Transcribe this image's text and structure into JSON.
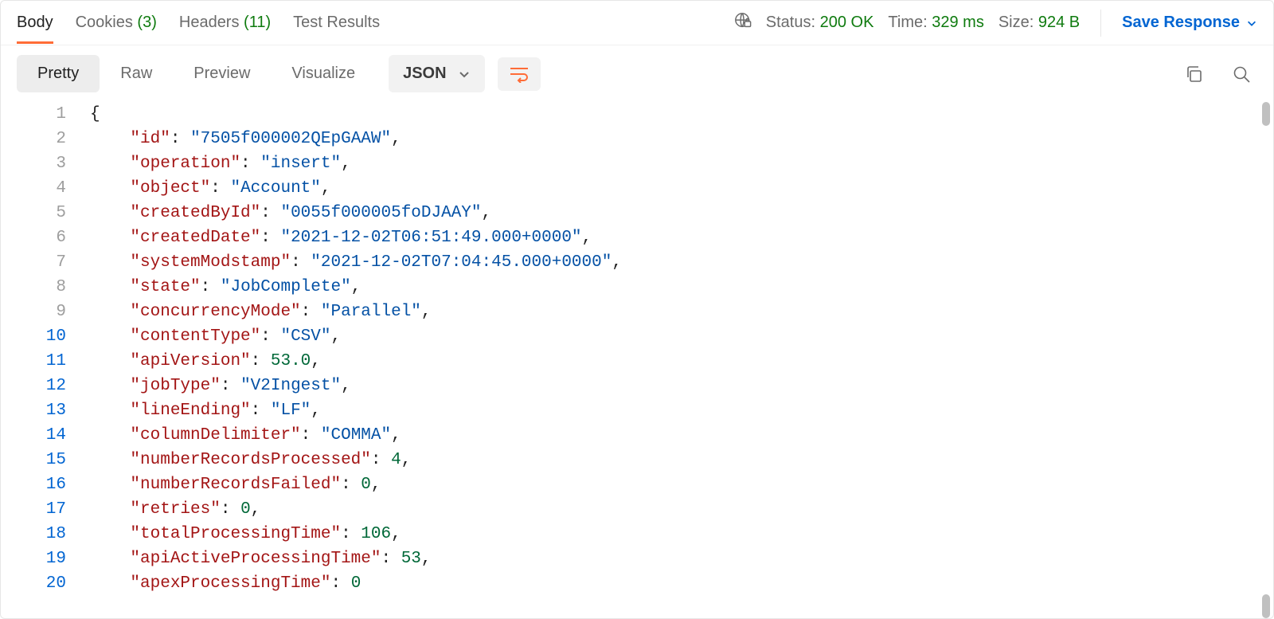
{
  "tabs": {
    "body": "Body",
    "cookies_label": "Cookies",
    "cookies_count": "(3)",
    "headers_label": "Headers",
    "headers_count": "(11)",
    "test_results": "Test Results"
  },
  "status": {
    "status_label": "Status:",
    "status_value": "200 OK",
    "time_label": "Time:",
    "time_value": "329 ms",
    "size_label": "Size:",
    "size_value": "924 B"
  },
  "save_response": "Save Response",
  "view_tabs": {
    "pretty": "Pretty",
    "raw": "Raw",
    "preview": "Preview",
    "visualize": "Visualize"
  },
  "format": "JSON",
  "json_body": {
    "id": "7505f000002QEpGAAW",
    "operation": "insert",
    "object": "Account",
    "createdById": "0055f000005foDJAAY",
    "createdDate": "2021-12-02T06:51:49.000+0000",
    "systemModstamp": "2021-12-02T07:04:45.000+0000",
    "state": "JobComplete",
    "concurrencyMode": "Parallel",
    "contentType": "CSV",
    "apiVersion": 53.0,
    "jobType": "V2Ingest",
    "lineEnding": "LF",
    "columnDelimiter": "COMMA",
    "numberRecordsProcessed": 4,
    "numberRecordsFailed": 0,
    "retries": 0,
    "totalProcessingTime": 106,
    "apiActiveProcessingTime": 53,
    "apexProcessingTime": 0
  },
  "code_lines": [
    {
      "n": 1,
      "tokens": [
        [
          "punc",
          "{"
        ]
      ]
    },
    {
      "n": 2,
      "tokens": [
        [
          "indent",
          "    "
        ],
        [
          "key",
          "\"id\""
        ],
        [
          "punc",
          ": "
        ],
        [
          "str",
          "\"7505f000002QEpGAAW\""
        ],
        [
          "punc",
          ","
        ]
      ]
    },
    {
      "n": 3,
      "tokens": [
        [
          "indent",
          "    "
        ],
        [
          "key",
          "\"operation\""
        ],
        [
          "punc",
          ": "
        ],
        [
          "str",
          "\"insert\""
        ],
        [
          "punc",
          ","
        ]
      ]
    },
    {
      "n": 4,
      "tokens": [
        [
          "indent",
          "    "
        ],
        [
          "key",
          "\"object\""
        ],
        [
          "punc",
          ": "
        ],
        [
          "str",
          "\"Account\""
        ],
        [
          "punc",
          ","
        ]
      ]
    },
    {
      "n": 5,
      "tokens": [
        [
          "indent",
          "    "
        ],
        [
          "key",
          "\"createdById\""
        ],
        [
          "punc",
          ": "
        ],
        [
          "str",
          "\"0055f000005foDJAAY\""
        ],
        [
          "punc",
          ","
        ]
      ]
    },
    {
      "n": 6,
      "tokens": [
        [
          "indent",
          "    "
        ],
        [
          "key",
          "\"createdDate\""
        ],
        [
          "punc",
          ": "
        ],
        [
          "str",
          "\"2021-12-02T06:51:49.000+0000\""
        ],
        [
          "punc",
          ","
        ]
      ]
    },
    {
      "n": 7,
      "tokens": [
        [
          "indent",
          "    "
        ],
        [
          "key",
          "\"systemModstamp\""
        ],
        [
          "punc",
          ": "
        ],
        [
          "str",
          "\"2021-12-02T07:04:45.000+0000\""
        ],
        [
          "punc",
          ","
        ]
      ]
    },
    {
      "n": 8,
      "tokens": [
        [
          "indent",
          "    "
        ],
        [
          "key",
          "\"state\""
        ],
        [
          "punc",
          ": "
        ],
        [
          "str",
          "\"JobComplete\""
        ],
        [
          "punc",
          ","
        ]
      ]
    },
    {
      "n": 9,
      "tokens": [
        [
          "indent",
          "    "
        ],
        [
          "key",
          "\"concurrencyMode\""
        ],
        [
          "punc",
          ": "
        ],
        [
          "str",
          "\"Parallel\""
        ],
        [
          "punc",
          ","
        ]
      ]
    },
    {
      "n": 10,
      "tokens": [
        [
          "indent",
          "    "
        ],
        [
          "key",
          "\"contentType\""
        ],
        [
          "punc",
          ": "
        ],
        [
          "str",
          "\"CSV\""
        ],
        [
          "punc",
          ","
        ]
      ]
    },
    {
      "n": 11,
      "tokens": [
        [
          "indent",
          "    "
        ],
        [
          "key",
          "\"apiVersion\""
        ],
        [
          "punc",
          ": "
        ],
        [
          "num",
          "53.0"
        ],
        [
          "punc",
          ","
        ]
      ]
    },
    {
      "n": 12,
      "tokens": [
        [
          "indent",
          "    "
        ],
        [
          "key",
          "\"jobType\""
        ],
        [
          "punc",
          ": "
        ],
        [
          "str",
          "\"V2Ingest\""
        ],
        [
          "punc",
          ","
        ]
      ]
    },
    {
      "n": 13,
      "tokens": [
        [
          "indent",
          "    "
        ],
        [
          "key",
          "\"lineEnding\""
        ],
        [
          "punc",
          ": "
        ],
        [
          "str",
          "\"LF\""
        ],
        [
          "punc",
          ","
        ]
      ]
    },
    {
      "n": 14,
      "tokens": [
        [
          "indent",
          "    "
        ],
        [
          "key",
          "\"columnDelimiter\""
        ],
        [
          "punc",
          ": "
        ],
        [
          "str",
          "\"COMMA\""
        ],
        [
          "punc",
          ","
        ]
      ]
    },
    {
      "n": 15,
      "tokens": [
        [
          "indent",
          "    "
        ],
        [
          "key",
          "\"numberRecordsProcessed\""
        ],
        [
          "punc",
          ": "
        ],
        [
          "num",
          "4"
        ],
        [
          "punc",
          ","
        ]
      ]
    },
    {
      "n": 16,
      "tokens": [
        [
          "indent",
          "    "
        ],
        [
          "key",
          "\"numberRecordsFailed\""
        ],
        [
          "punc",
          ": "
        ],
        [
          "num",
          "0"
        ],
        [
          "punc",
          ","
        ]
      ]
    },
    {
      "n": 17,
      "tokens": [
        [
          "indent",
          "    "
        ],
        [
          "key",
          "\"retries\""
        ],
        [
          "punc",
          ": "
        ],
        [
          "num",
          "0"
        ],
        [
          "punc",
          ","
        ]
      ]
    },
    {
      "n": 18,
      "tokens": [
        [
          "indent",
          "    "
        ],
        [
          "key",
          "\"totalProcessingTime\""
        ],
        [
          "punc",
          ": "
        ],
        [
          "num",
          "106"
        ],
        [
          "punc",
          ","
        ]
      ]
    },
    {
      "n": 19,
      "tokens": [
        [
          "indent",
          "    "
        ],
        [
          "key",
          "\"apiActiveProcessingTime\""
        ],
        [
          "punc",
          ": "
        ],
        [
          "num",
          "53"
        ],
        [
          "punc",
          ","
        ]
      ]
    },
    {
      "n": 20,
      "tokens": [
        [
          "indent",
          "    "
        ],
        [
          "key",
          "\"apexProcessingTime\""
        ],
        [
          "punc",
          ": "
        ],
        [
          "num",
          "0"
        ]
      ]
    }
  ]
}
